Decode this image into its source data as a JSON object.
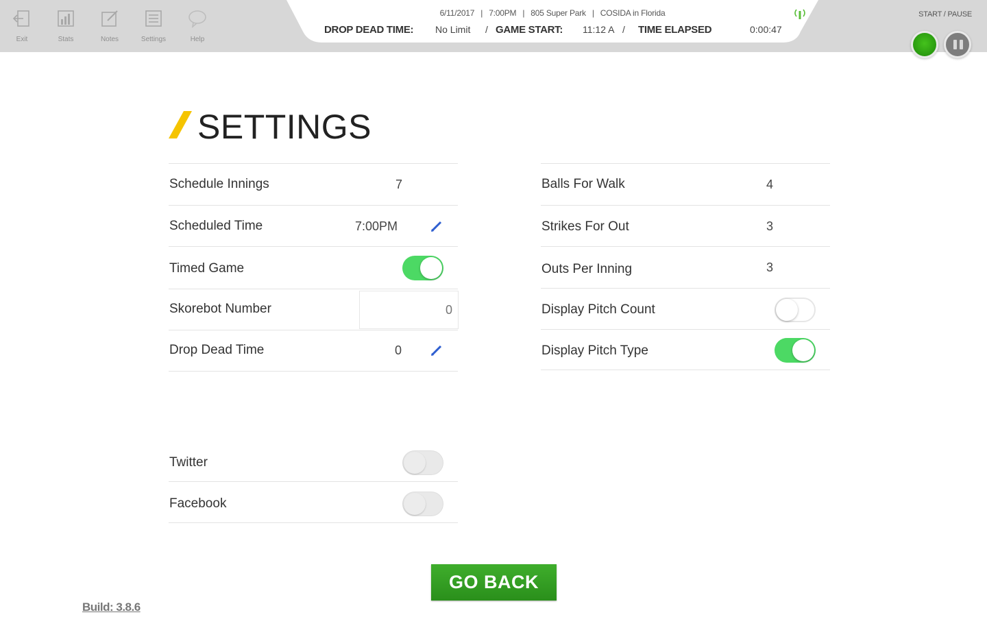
{
  "toolbar": {
    "items": [
      {
        "label": "Exit",
        "icon": "exit-icon"
      },
      {
        "label": "Stats",
        "icon": "stats-icon"
      },
      {
        "label": "Notes",
        "icon": "notes-icon"
      },
      {
        "label": "Settings",
        "icon": "settings-icon"
      },
      {
        "label": "Help",
        "icon": "help-icon"
      }
    ]
  },
  "game_info": {
    "date": "6/11/2017",
    "time": "7:00PM",
    "venue": "805 Super Park",
    "event": "COSIDA in Florida",
    "drop_dead_label": "DROP DEAD TIME:",
    "drop_dead_value": "No Limit",
    "game_start_label": "GAME START:",
    "game_start_value": "11:12 A",
    "time_elapsed_label": "TIME ELAPSED",
    "time_elapsed_value": "0:00:47",
    "signal_icon": "signal-icon"
  },
  "controls": {
    "start_pause_label": "START / PAUSE",
    "start_color": "#2f9f14",
    "pause_color": "#7d7d7d"
  },
  "page": {
    "title": "SETTINGS",
    "accent_color": "#f5c400"
  },
  "left_settings": {
    "schedule_innings": {
      "label": "Schedule Innings",
      "value": "7"
    },
    "scheduled_time": {
      "label": "Scheduled Time",
      "value": "7:00PM"
    },
    "timed_game": {
      "label": "Timed Game",
      "on": true
    },
    "skorebot_number": {
      "label": "Skorebot Number",
      "placeholder": "0"
    },
    "drop_dead_time": {
      "label": "Drop Dead Time",
      "value": "0"
    }
  },
  "right_settings": {
    "balls_for_walk": {
      "label": "Balls For Walk",
      "value": "4"
    },
    "strikes_for_out": {
      "label": "Strikes For Out",
      "value": "3"
    },
    "outs_per_inning": {
      "label": "Outs Per Inning",
      "value": "3"
    },
    "display_pitch_count": {
      "label": "Display Pitch Count",
      "on": false
    },
    "display_pitch_type": {
      "label": "Display Pitch Type",
      "on": true
    }
  },
  "social": {
    "twitter": {
      "label": "Twitter",
      "on": false
    },
    "facebook": {
      "label": "Facebook",
      "on": false
    }
  },
  "footer": {
    "go_back_label": "GO BACK",
    "build_label": "Build: 3.8.6",
    "go_back_color": "#34a023"
  },
  "colors": {
    "toggle_on": "#4cd964",
    "edit_icon": "#2f5fd0"
  }
}
